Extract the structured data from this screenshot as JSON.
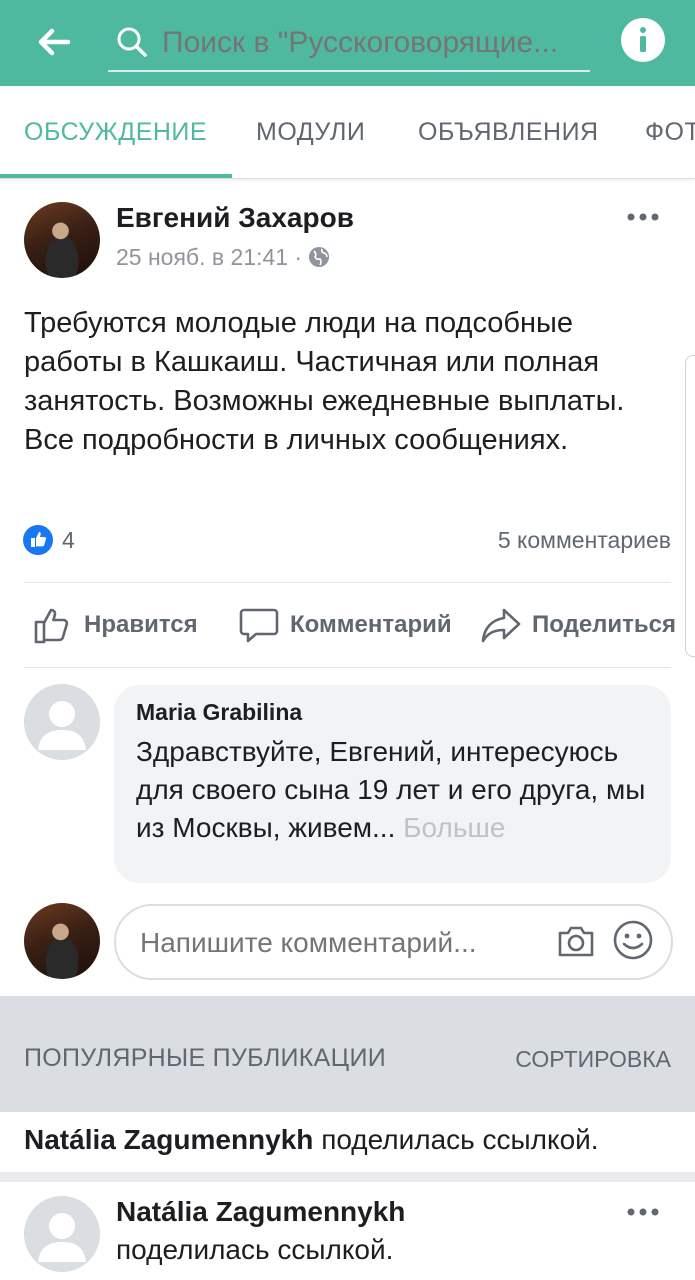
{
  "header": {
    "search_placeholder": "Поиск в \"Русскоговорящие...",
    "back_icon": "arrow-left-icon",
    "info_icon": "info-icon"
  },
  "tabs": [
    {
      "label": "ОБСУЖДЕНИЕ",
      "active": true
    },
    {
      "label": "МОДУЛИ",
      "active": false
    },
    {
      "label": "ОБЪЯВЛЕНИЯ",
      "active": false
    },
    {
      "label": "ФОТ",
      "active": false
    }
  ],
  "post": {
    "author": "Евгений Захаров",
    "time": "25 нояб. в 21:41 ·",
    "text": "Требуются молодые люди на подсобные работы в Кашкаиш. Частичная или полная занятость. Возможны ежедневные выплаты. Все подробности в личных сообщениях.",
    "likes": "4",
    "comments": "5 комментариев",
    "actions": {
      "like": "Нравится",
      "comment": "Комментарий",
      "share": "Поделиться"
    }
  },
  "comment": {
    "author": "Maria Grabilina",
    "text": "Здравствуйте, Евгений, интересуюсь для своего сына 19 лет и его друга, мы из Москвы, живем...",
    "more": "Больше"
  },
  "comment_input": {
    "placeholder": "Напишите комментарий..."
  },
  "popular": {
    "title": "ПОПУЛЯРНЫЕ ПУБЛИКАЦИИ",
    "sort": "СОРТИРОВКА",
    "share_author": "Natália Zagumennykh",
    "share_action": "поделилась ссылкой.",
    "post_author": "Natália Zagumennykh",
    "post_action": "поделилась ссылкой."
  },
  "colors": {
    "accent": "#4fb99f",
    "like_blue": "#1877f2"
  }
}
